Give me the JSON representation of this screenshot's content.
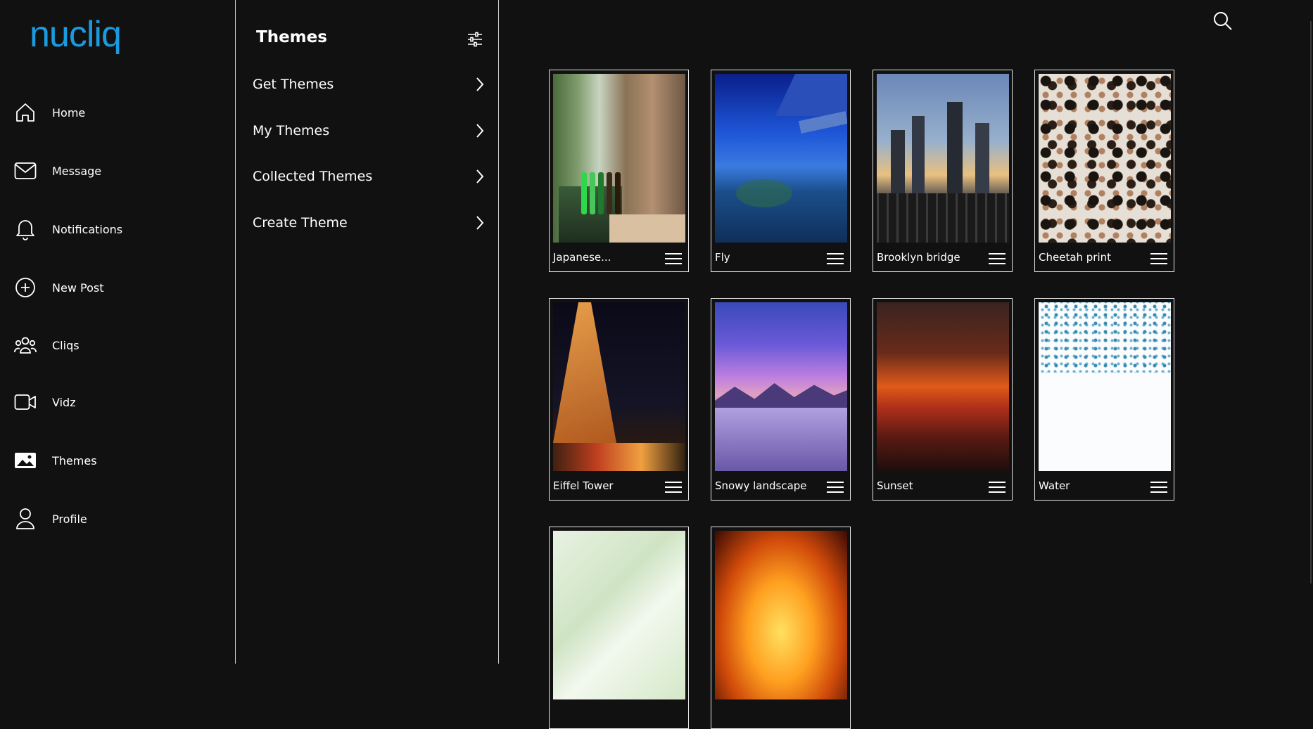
{
  "brand": {
    "logo_text": "nucliq",
    "accent": "#1a9be0"
  },
  "sidebar": {
    "items": [
      {
        "label": "Home",
        "icon": "home-icon"
      },
      {
        "label": "Message",
        "icon": "mail-icon"
      },
      {
        "label": "Notifications",
        "icon": "bell-icon"
      },
      {
        "label": "New Post",
        "icon": "plus-circle-icon"
      },
      {
        "label": "Cliqs",
        "icon": "group-icon"
      },
      {
        "label": "Vidz",
        "icon": "video-icon"
      },
      {
        "label": "Themes",
        "icon": "image-icon",
        "active": true
      },
      {
        "label": "Profile",
        "icon": "user-icon"
      }
    ]
  },
  "themes_panel": {
    "title": "Themes",
    "menu": [
      {
        "label": "Get Themes"
      },
      {
        "label": "My Themes"
      },
      {
        "label": "Collected Themes"
      },
      {
        "label": "Create Theme"
      }
    ]
  },
  "themes": [
    {
      "name": "Japanese...",
      "image": "window with bottles"
    },
    {
      "name": "Fly",
      "image": "airplane wing over sea"
    },
    {
      "name": "Brooklyn bridge",
      "image": "bridge cables and skyline"
    },
    {
      "name": "Cheetah print",
      "image": "leopard spots"
    },
    {
      "name": "Eiffel Tower",
      "image": "lit tower at night"
    },
    {
      "name": "Snowy landscape",
      "image": "purple sky snow mountains"
    },
    {
      "name": "Sunset",
      "image": "red orange clouds"
    },
    {
      "name": "Water",
      "image": "water splash on white"
    },
    {
      "name": "",
      "image": "pale green texture"
    },
    {
      "name": "",
      "image": "fire flames"
    }
  ]
}
